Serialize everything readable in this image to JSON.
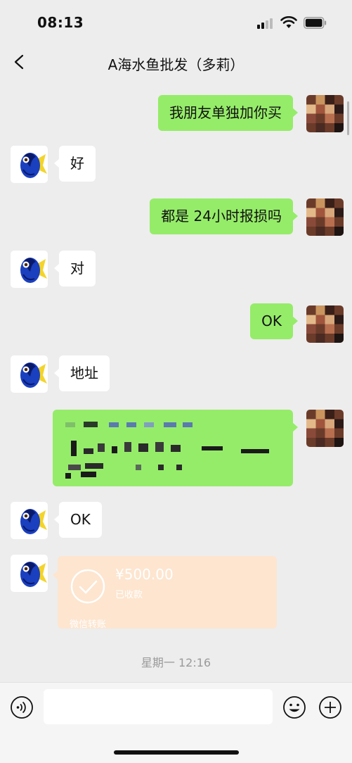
{
  "status_bar": {
    "time": "08:13"
  },
  "nav": {
    "title": "A海水鱼批发（多莉）"
  },
  "messages": [
    {
      "side": "right",
      "text": "我朋友单独加你买"
    },
    {
      "side": "left",
      "text": "好"
    },
    {
      "side": "right",
      "text": "都是 24小时报损吗"
    },
    {
      "side": "left",
      "text": "对"
    },
    {
      "side": "right",
      "text": "OK"
    },
    {
      "side": "left",
      "text": "地址"
    },
    {
      "side": "right",
      "text": ""
    },
    {
      "side": "left",
      "text": "OK"
    }
  ],
  "transfer": {
    "amount": "¥500.00",
    "status": "已收款",
    "footer": "微信转账"
  },
  "timestamp": "星期一 12:16",
  "input": {
    "value": ""
  },
  "colors": {
    "outgoing_bubble": "#95ec69",
    "incoming_bubble": "#ffffff",
    "transfer_card": "#fde5cf",
    "background": "#ededed"
  },
  "icons": [
    "back-icon",
    "voice-icon",
    "emoji-icon",
    "plus-icon",
    "check-icon"
  ]
}
